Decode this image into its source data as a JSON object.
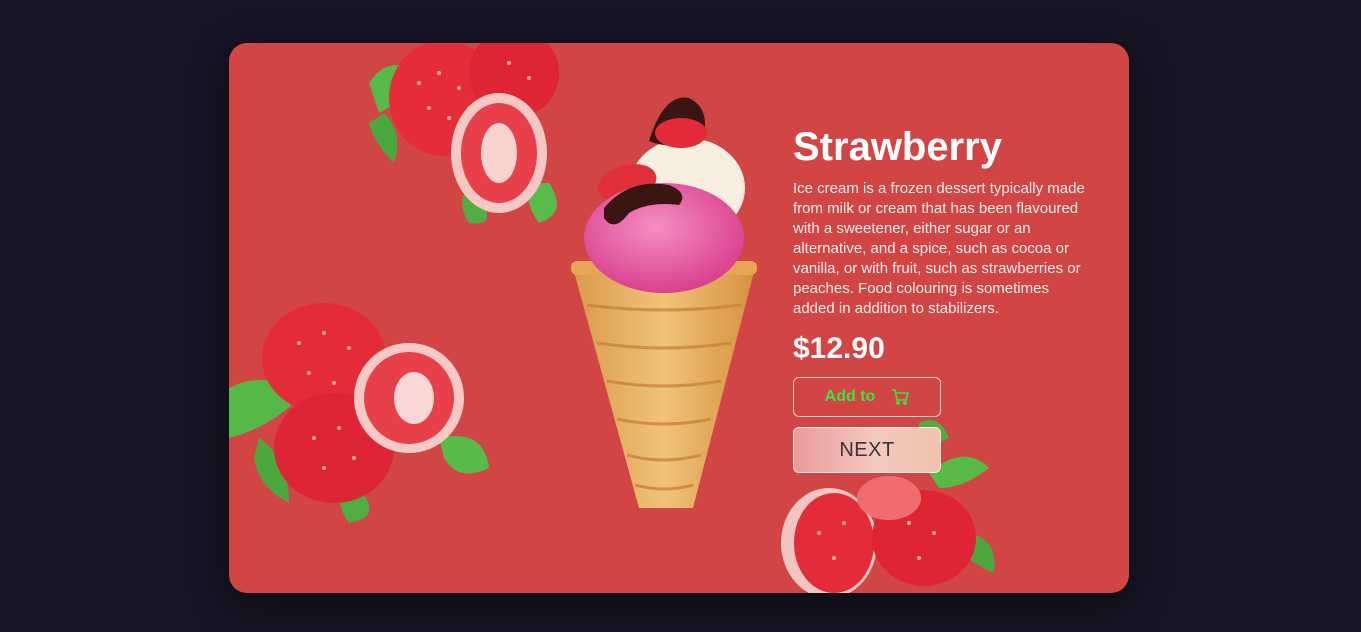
{
  "product": {
    "title": "Strawberry",
    "description": "Ice cream is a frozen dessert typically made from milk or cream that has been flavoured with a sweetener, either sugar or an alternative, and a spice, such as cocoa or vanilla, or with fruit, such as strawberries or peaches. Food colouring is sometimes added in addition to stabilizers.",
    "price": "$12.90"
  },
  "actions": {
    "add_label": "Add to",
    "add_icon": "cart-icon",
    "next_label": "NEXT"
  },
  "colors": {
    "page_background": "#171526",
    "card_background": "#d24545",
    "add_text": "#39e639"
  }
}
